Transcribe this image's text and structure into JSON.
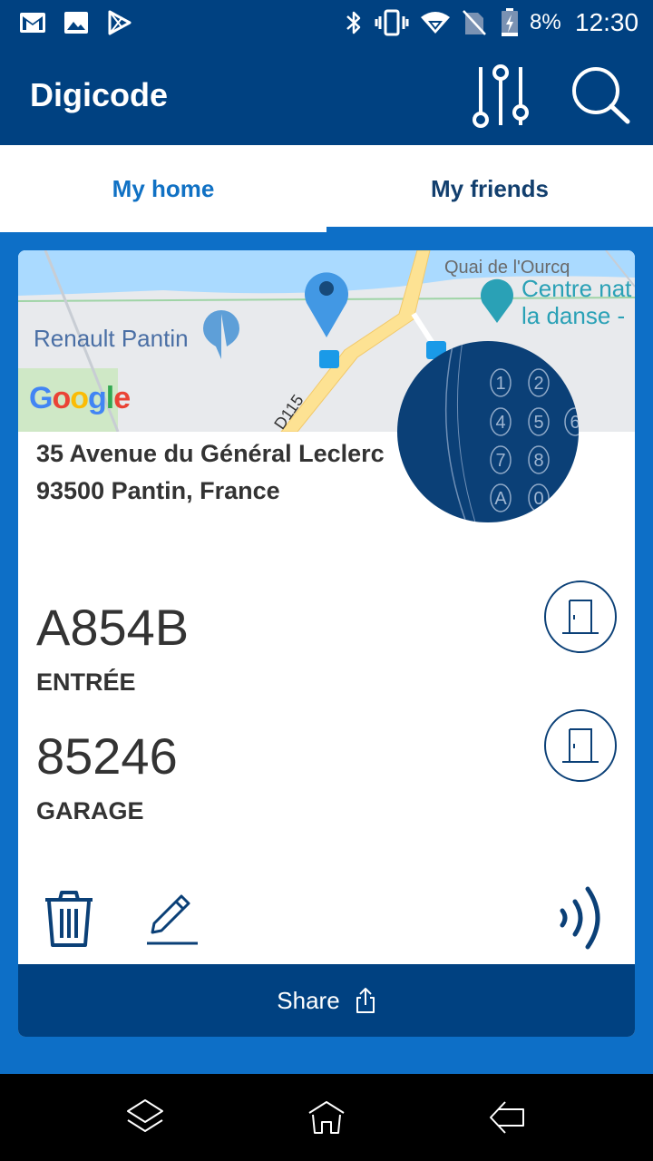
{
  "status_bar": {
    "icons_left": [
      "gmail-icon",
      "photo-icon",
      "play-store-icon"
    ],
    "icons_right": [
      "bluetooth-icon",
      "vibrate-icon",
      "wifi-icon",
      "no-sim-icon",
      "battery-charging-icon"
    ],
    "battery": "8%",
    "time": "12:30"
  },
  "appbar": {
    "title": "Digicode",
    "filter_icon": "sliders-icon",
    "search_icon": "search-icon"
  },
  "tabs": [
    {
      "label": "My home",
      "selected": false
    },
    {
      "label": "My friends",
      "selected": true
    }
  ],
  "map": {
    "labels": {
      "renault": "Renault Pantin",
      "quai": "Quai de l'Ourcq",
      "centre_line1": "Centre nat",
      "centre_line2": "la danse -",
      "road": "D115",
      "google": [
        "G",
        "o",
        "o",
        "g",
        "l",
        "e"
      ]
    },
    "google_colors": [
      "#4285F4",
      "#EA4335",
      "#FBBC05",
      "#4285F4",
      "#34A853",
      "#EA4335"
    ]
  },
  "address": {
    "line1": "35 Avenue du Général Leclerc",
    "line2": "93500 Pantin, France"
  },
  "keypad": [
    "1",
    "2",
    "4",
    "5",
    "6",
    "7",
    "8",
    "A",
    "0"
  ],
  "codes": [
    {
      "value": "A854B",
      "label": "ENTRÉE"
    },
    {
      "value": "85246",
      "label": "GARAGE"
    }
  ],
  "actions": {
    "delete_icon": "trash-icon",
    "edit_icon": "pencil-icon",
    "nfc_icon": "nfc-icon"
  },
  "share": {
    "label": "Share",
    "icon": "share-icon"
  },
  "navbar": {
    "icons": [
      "recent-apps-icon",
      "home-icon",
      "back-icon"
    ]
  },
  "colors": {
    "primary_dark": "#004181",
    "primary": "#0d6fc7",
    "text": "#333333"
  }
}
